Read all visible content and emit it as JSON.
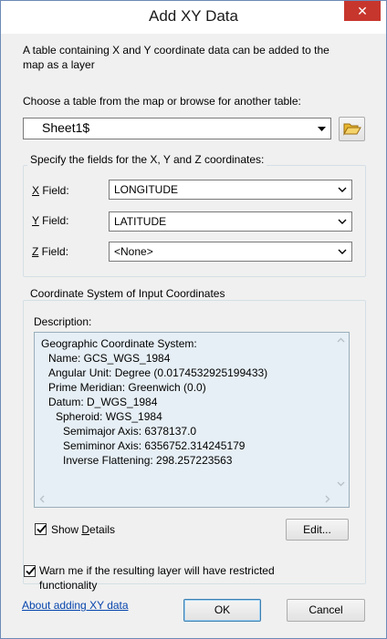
{
  "window": {
    "title": "Add XY Data",
    "close_glyph": "✕"
  },
  "intro": {
    "line1": "A table containing X and Y coordinate data can be added to the",
    "line2": "map as a layer"
  },
  "table_section": {
    "label": "Choose a table from the map or browse for another table:",
    "selected": "Sheet1$",
    "browse_icon": "folder-open-icon"
  },
  "fields_group": {
    "title": "Specify the fields for the X, Y and Z coordinates:",
    "x": {
      "accel": "X",
      "rest": " Field:",
      "value": "LONGITUDE"
    },
    "y": {
      "accel": "Y",
      "rest": " Field:",
      "value": "LATITUDE"
    },
    "z": {
      "accel": "Z",
      "rest": " Field:",
      "value": "<None>"
    }
  },
  "coord_group": {
    "title": "Coordinate System of Input Coordinates",
    "description_label": "Description:",
    "description_lines": [
      "Geographic Coordinate System:",
      "Name: GCS_WGS_1984",
      "Angular Unit: Degree (0.0174532925199433)",
      "Prime Meridian: Greenwich (0.0)",
      "Datum: D_WGS_1984",
      "Spheroid: WGS_1984",
      "Semimajor Axis: 6378137.0",
      "Semiminor Axis: 6356752.314245179",
      "Inverse Flattening: 298.257223563"
    ],
    "show_details": {
      "pre": "Show ",
      "accel": "D",
      "post": "etails",
      "checked": true
    },
    "edit_label": "Edit..."
  },
  "warn": {
    "line1": "Warn me if the resulting layer will have restricted",
    "line2": "functionality",
    "accel": "W",
    "checked": true
  },
  "footer": {
    "help_link": "About adding XY data",
    "ok_label": "OK",
    "cancel_label": "Cancel"
  },
  "colors": {
    "close_bg": "#c7362d",
    "link": "#0645ad",
    "description_bg": "#e6eff5"
  }
}
